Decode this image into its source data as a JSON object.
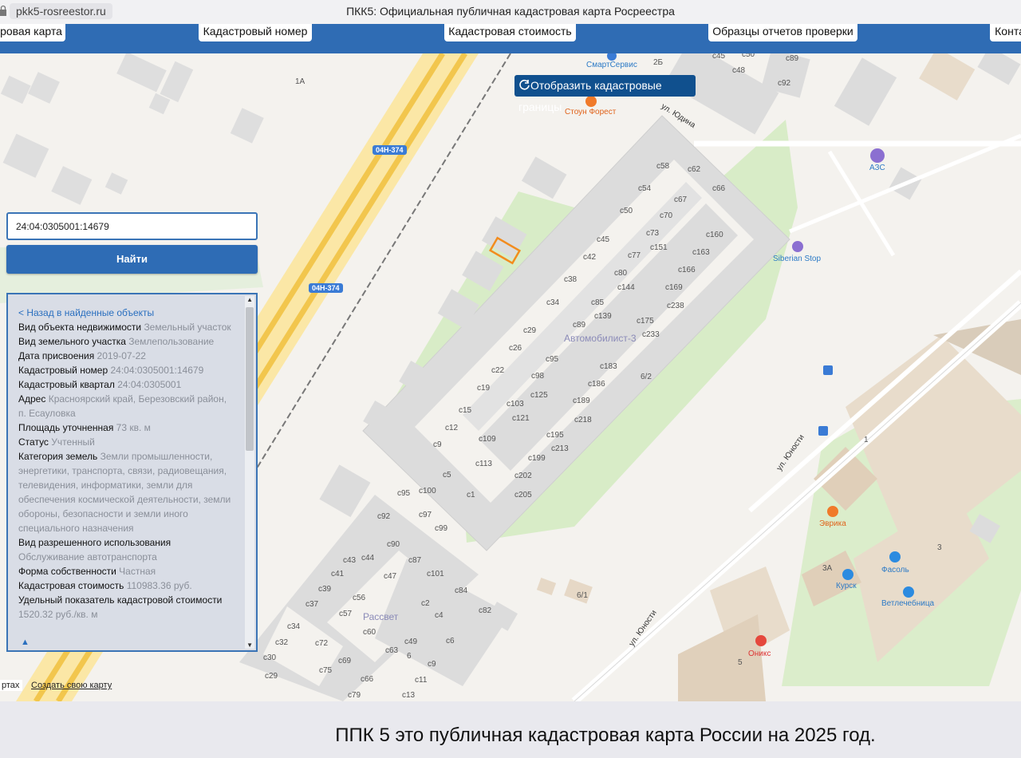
{
  "browser": {
    "url": "pkk5-rosreestor.ru",
    "title": "ПКК5: Официальная публичная кадастровая карта Росреестра"
  },
  "nav": {
    "tabs": [
      "ровая карта",
      "Кадастровый номер",
      "Кадастровая стоимость",
      "Образцы отчетов проверки",
      "Конта"
    ]
  },
  "map": {
    "cadastral_button": "Отобразить кадастровые границы",
    "road_badge": "04Н-374",
    "district_name": "Автомобилист-3",
    "district_name_2": "Рассвет",
    "streets": [
      "ул. Юдина",
      "ул. Юности",
      "ул. Юности"
    ],
    "pois": {
      "smartservice": "СмартСервис",
      "stone_forest": "Стоун Форест",
      "azs": "АЗС",
      "siberian_stop": "Siberian Stop",
      "evrika": "Эврика",
      "fasol": "Фасоль",
      "kursk": "Курск",
      "vet": "Ветлечебница",
      "oniks": "Оникс"
    },
    "footer": {
      "left_text": "ртах",
      "create_map": "Создать свою карту"
    }
  },
  "search": {
    "value": "24:04:0305001:14679",
    "button": "Найти"
  },
  "info": {
    "back_link": "< Назад в найденные объекты",
    "fields": [
      {
        "label": "Вид объекта недвижимости",
        "value": "Земельный участок"
      },
      {
        "label": "Вид земельного участка",
        "value": "Землепользование"
      },
      {
        "label": "Дата присвоения",
        "value": "2019-07-22"
      },
      {
        "label": "Кадастровый номер",
        "value": "24:04:0305001:14679"
      },
      {
        "label": "Кадастровый квартал",
        "value": "24:04:0305001"
      },
      {
        "label": "Адрес",
        "value": "Красноярский край, Березовский район, п. Есауловка"
      },
      {
        "label": "Площадь уточненная",
        "value": "73 кв. м"
      },
      {
        "label": "Статус",
        "value": "Учтенный"
      },
      {
        "label": "Категория земель",
        "value": "Земли промышленности, энергетики, транспорта, связи, радиовещания, телевидения, информатики, земли для обеспечения космической деятельности, земли обороны, безопасности и земли иного специального назначения"
      },
      {
        "label": "Вид разрешенного использования",
        "value": "Обслуживание автотранспорта"
      },
      {
        "label": "Форма собственности",
        "value": "Частная"
      },
      {
        "label": "Кадастровая стоимость",
        "value": "110983.36 руб."
      },
      {
        "label": "Удельный показатель кадастровой стоимости",
        "value": "1520.32 руб./кв. м"
      }
    ]
  },
  "caption": "ППК 5 это публичная кадастровая карта России на 2025 год."
}
